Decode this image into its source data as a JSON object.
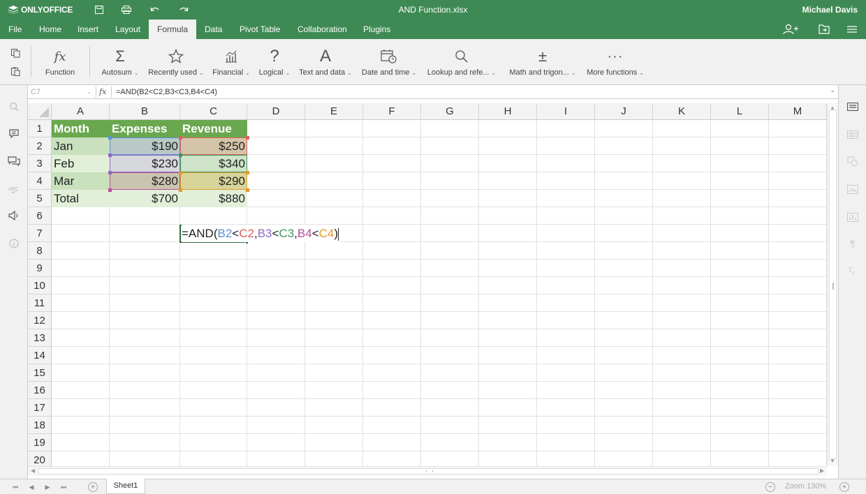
{
  "app": {
    "logo": "ONLYOFFICE",
    "doc_title": "AND Function.xlsx",
    "user": "Michael Davis"
  },
  "menu": {
    "tabs": [
      "File",
      "Home",
      "Insert",
      "Layout",
      "Formula",
      "Data",
      "Pivot Table",
      "Collaboration",
      "Plugins"
    ],
    "active": "Formula"
  },
  "toolbar": {
    "function": "Function",
    "autosum": "Autosum",
    "recently_used": "Recently used",
    "financial": "Financial",
    "logical": "Logical",
    "text_and_data": "Text and data",
    "date_and_time": "Date and time",
    "lookup": "Lookup and refe...",
    "math": "Math and trigon...",
    "more": "More functions"
  },
  "formula_bar": {
    "name_box": "C7",
    "fx": "fx",
    "formula": "=AND(B2<C2,B3<C3,B4<C4)"
  },
  "columns": [
    "A",
    "B",
    "C",
    "D",
    "E",
    "F",
    "G",
    "H",
    "I",
    "J",
    "K",
    "L",
    "M"
  ],
  "rows": [
    "1",
    "2",
    "3",
    "4",
    "5",
    "6",
    "7",
    "8",
    "9",
    "10",
    "11",
    "12",
    "13",
    "14",
    "15",
    "16",
    "17",
    "18",
    "19",
    "20"
  ],
  "cells": {
    "A1": "Month",
    "B1": "Expenses",
    "C1": "Revenue",
    "A2": "Jan",
    "B2": "$190",
    "C2": "$250",
    "A3": "Feb",
    "B3": "$230",
    "C3": "$340",
    "A4": "Mar",
    "B4": "$280",
    "C4": "$290",
    "A5": "Total",
    "B5": "$700",
    "C5": "$880"
  },
  "edit_cell": {
    "parts": [
      {
        "text": "=AND(",
        "color": "#222222"
      },
      {
        "text": "B2",
        "color": "#5b8fd6"
      },
      {
        "text": "<",
        "color": "#222222"
      },
      {
        "text": "C2",
        "color": "#e0605a"
      },
      {
        "text": ",",
        "color": "#222222"
      },
      {
        "text": "B3",
        "color": "#8e6bc0"
      },
      {
        "text": "<",
        "color": "#222222"
      },
      {
        "text": "C3",
        "color": "#3c9a5c"
      },
      {
        "text": ",",
        "color": "#222222"
      },
      {
        "text": "B4",
        "color": "#b64f9c"
      },
      {
        "text": "<",
        "color": "#222222"
      },
      {
        "text": "C4",
        "color": "#e09a2a"
      },
      {
        "text": ")",
        "color": "#222222"
      }
    ]
  },
  "sheet": {
    "name": "Sheet1"
  },
  "status": {
    "zoom": "Zoom 130%"
  },
  "colors": {
    "brand": "#3f8a54",
    "header_fill": "#6aa84f"
  }
}
